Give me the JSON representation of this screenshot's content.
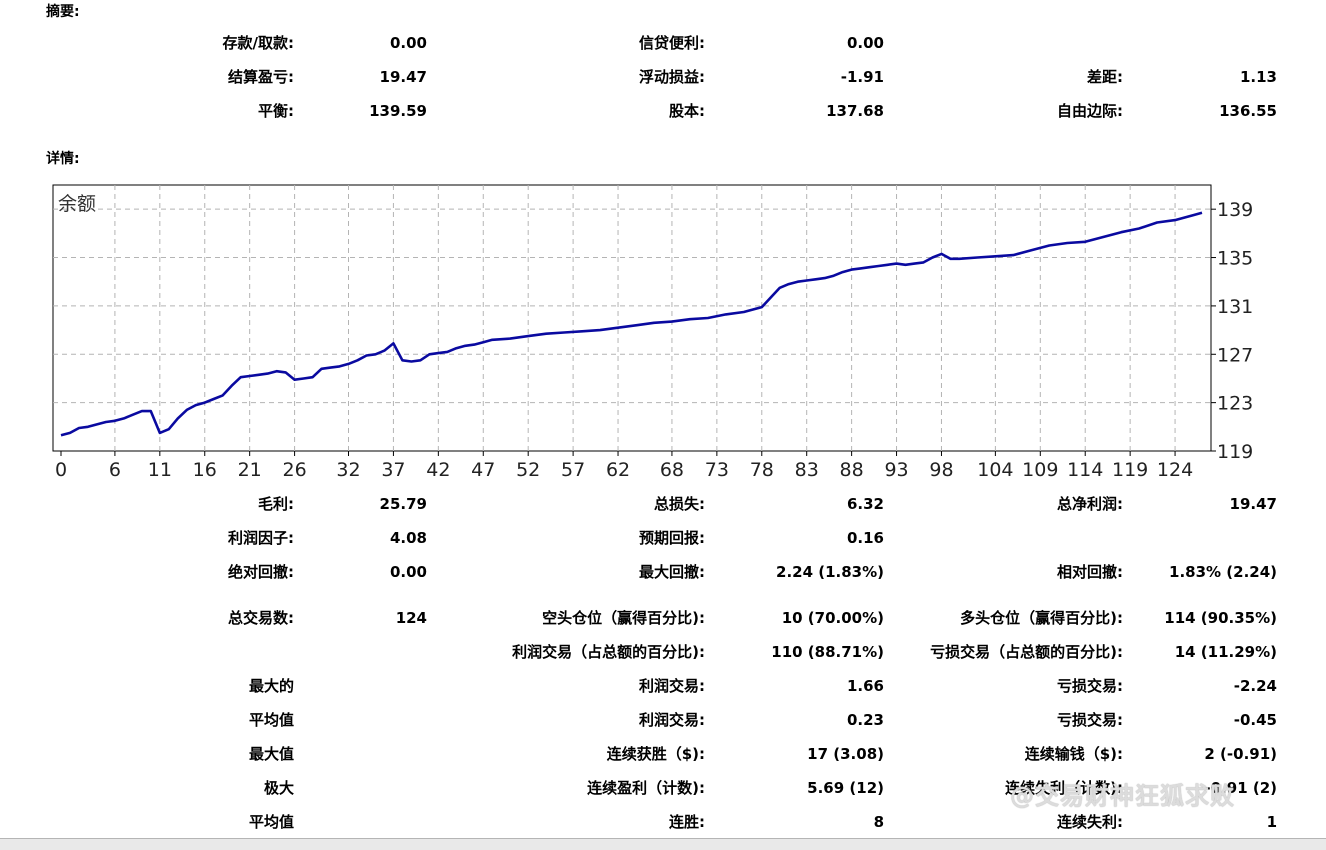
{
  "summary": {
    "title": "摘要:",
    "rows": [
      [
        {
          "label": "存款/取款:",
          "value": "0.00"
        },
        {
          "label": "信贷便利:",
          "value": "0.00"
        },
        {
          "label": "",
          "value": ""
        }
      ],
      [
        {
          "label": "结算盈亏:",
          "value": "19.47"
        },
        {
          "label": "浮动损益:",
          "value": "-1.91"
        },
        {
          "label": "差距:",
          "value": "1.13"
        }
      ],
      [
        {
          "label": "平衡:",
          "value": "139.59"
        },
        {
          "label": "股本:",
          "value": "137.68"
        },
        {
          "label": "自由边际:",
          "value": "136.55"
        }
      ]
    ]
  },
  "details": {
    "title": "详情:"
  },
  "chart_data": {
    "type": "line",
    "title": "余额",
    "xlabel": "",
    "ylabel": "",
    "x_ticks": [
      "0",
      "6",
      "11",
      "16",
      "21",
      "26",
      "32",
      "37",
      "42",
      "47",
      "52",
      "57",
      "62",
      "68",
      "73",
      "78",
      "83",
      "88",
      "93",
      "98",
      "104",
      "109",
      "114",
      "119",
      "124"
    ],
    "y_ticks": [
      "119",
      "123",
      "127",
      "131",
      "135",
      "139"
    ],
    "xlim": [
      0,
      128
    ],
    "ylim": [
      119,
      141
    ],
    "grid": true,
    "colors": {
      "line": "#0a0aa0",
      "grid": "#b4b4b4"
    },
    "series": [
      {
        "x": [
          0,
          1,
          2,
          3,
          4,
          5,
          6,
          7,
          8,
          9,
          10,
          11,
          12,
          13,
          14,
          15,
          16,
          17,
          18,
          19,
          20,
          21,
          22,
          23,
          24,
          25,
          26,
          27,
          28,
          29,
          30,
          31,
          32,
          33,
          34,
          35,
          36,
          37,
          38,
          39,
          40,
          41,
          42,
          43,
          44,
          45,
          46,
          47,
          48,
          50,
          52,
          54,
          56,
          58,
          60,
          62,
          64,
          66,
          68,
          70,
          72,
          74,
          76,
          78,
          80,
          81,
          82,
          83,
          84,
          85,
          86,
          87,
          88,
          89,
          90,
          91,
          92,
          93,
          94,
          95,
          96,
          97,
          98,
          99,
          100,
          102,
          104,
          106,
          108,
          110,
          112,
          114,
          116,
          118,
          120,
          122,
          124,
          126,
          127
        ],
        "y": [
          120.3,
          120.5,
          120.9,
          121.0,
          121.2,
          121.4,
          121.5,
          121.7,
          122.0,
          122.3,
          122.3,
          120.5,
          120.8,
          121.7,
          122.4,
          122.8,
          123.0,
          123.3,
          123.6,
          124.4,
          125.1,
          125.2,
          125.3,
          125.4,
          125.6,
          125.5,
          124.9,
          125.0,
          125.1,
          125.8,
          125.9,
          126.0,
          126.2,
          126.5,
          126.9,
          127.0,
          127.3,
          127.9,
          126.5,
          126.4,
          126.5,
          127.0,
          127.1,
          127.2,
          127.5,
          127.7,
          127.8,
          128.0,
          128.2,
          128.3,
          128.5,
          128.7,
          128.8,
          128.9,
          129.0,
          129.2,
          129.4,
          129.6,
          129.7,
          129.9,
          130.0,
          130.3,
          130.5,
          130.9,
          132.5,
          132.8,
          133.0,
          133.1,
          133.2,
          133.3,
          133.5,
          133.8,
          134.0,
          134.1,
          134.2,
          134.3,
          134.4,
          134.5,
          134.4,
          134.5,
          134.6,
          135.0,
          135.3,
          134.9,
          134.9,
          135.0,
          135.1,
          135.2,
          135.6,
          136.0,
          136.2,
          136.3,
          136.7,
          137.1,
          137.4,
          137.9,
          138.1,
          138.5,
          138.7
        ]
      }
    ]
  },
  "stats": [
    {
      "c1": {
        "label": "毛利:",
        "value": "25.79"
      },
      "c2": {
        "label": "总损失:",
        "value": "6.32"
      },
      "c3": {
        "label": "总净利润:",
        "value": "19.47"
      }
    },
    {
      "c1": {
        "label": "利润因子:",
        "value": "4.08"
      },
      "c2": {
        "label": "预期回报:",
        "value": "0.16"
      },
      "c3": {
        "label": "",
        "value": ""
      }
    },
    {
      "c1": {
        "label": "绝对回撤:",
        "value": "0.00"
      },
      "c2": {
        "label": "最大回撤:",
        "value": "2.24 (1.83%)"
      },
      "c3": {
        "label": "相对回撤:",
        "value": "1.83% (2.24)"
      }
    },
    {
      "c1": {
        "label": "总交易数:",
        "value": "124"
      },
      "c2": {
        "label": "空头仓位（赢得百分比):",
        "value": "10 (70.00%)"
      },
      "c3": {
        "label": "多头仓位（赢得百分比):",
        "value": "114 (90.35%)"
      }
    },
    {
      "c1": {
        "label": "",
        "value": ""
      },
      "c2": {
        "label": "利润交易（占总额的百分比):",
        "value": "110 (88.71%)"
      },
      "c3": {
        "label": "亏损交易（占总额的百分比):",
        "value": "14 (11.29%)"
      }
    },
    {
      "c1": {
        "label": "最大的",
        "value": ""
      },
      "c2": {
        "label": "利润交易:",
        "value": "1.66"
      },
      "c3": {
        "label": "亏损交易:",
        "value": "-2.24"
      }
    },
    {
      "c1": {
        "label": "平均值",
        "value": ""
      },
      "c2": {
        "label": "利润交易:",
        "value": "0.23"
      },
      "c3": {
        "label": "亏损交易:",
        "value": "-0.45"
      }
    },
    {
      "c1": {
        "label": "最大值",
        "value": ""
      },
      "c2": {
        "label": "连续获胜（$):",
        "value": "17 (3.08)"
      },
      "c3": {
        "label": "连续输钱（$):",
        "value": "2 (-0.91)"
      }
    },
    {
      "c1": {
        "label": "极大",
        "value": ""
      },
      "c2": {
        "label": "连续盈利（计数):",
        "value": "5.69 (12)"
      },
      "c3": {
        "label": "连续失利（计数):",
        "value": "-0.91 (2)"
      }
    },
    {
      "c1": {
        "label": "平均值",
        "value": ""
      },
      "c2": {
        "label": "连胜:",
        "value": "8"
      },
      "c3": {
        "label": "连续失利:",
        "value": "1"
      }
    }
  ],
  "watermark": "@交易财神狂狐求败"
}
